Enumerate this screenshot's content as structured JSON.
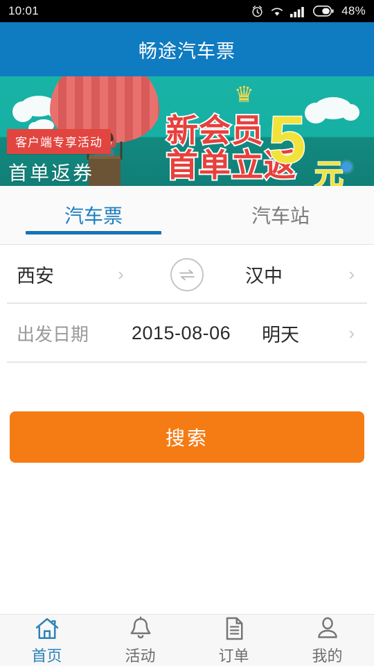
{
  "statusbar": {
    "time": "10:01",
    "battery_percent": "48%",
    "icons": [
      "alarm-icon",
      "wifi-icon",
      "signal-icon",
      "battery-icon"
    ]
  },
  "header": {
    "title": "畅途汽车票",
    "background_color": "#0f7bc0"
  },
  "banner": {
    "tag_label": "客户端专享活动",
    "caption": "首单返券",
    "promo_line1": "新会员",
    "promo_line2": "首单立返",
    "promo_number": "5",
    "promo_unit": "元",
    "dot_color": "#3d9be0",
    "background_color": "#16b0a4"
  },
  "tabs": [
    {
      "label": "汽车票",
      "active": true
    },
    {
      "label": "汽车站",
      "active": false
    }
  ],
  "form": {
    "from_city": "西安",
    "to_city": "汉中",
    "swap_icon": "swap-icon",
    "date_label": "出发日期",
    "date_value": "2015-08-06",
    "date_relative": "明天"
  },
  "search": {
    "label": "搜索",
    "color": "#f57b14"
  },
  "bottom_nav": [
    {
      "label": "首页",
      "icon": "home-icon",
      "active": true
    },
    {
      "label": "活动",
      "icon": "bell-icon",
      "active": false
    },
    {
      "label": "订单",
      "icon": "document-icon",
      "active": false
    },
    {
      "label": "我的",
      "icon": "person-icon",
      "active": false
    }
  ],
  "accent_color": "#1a72b5"
}
